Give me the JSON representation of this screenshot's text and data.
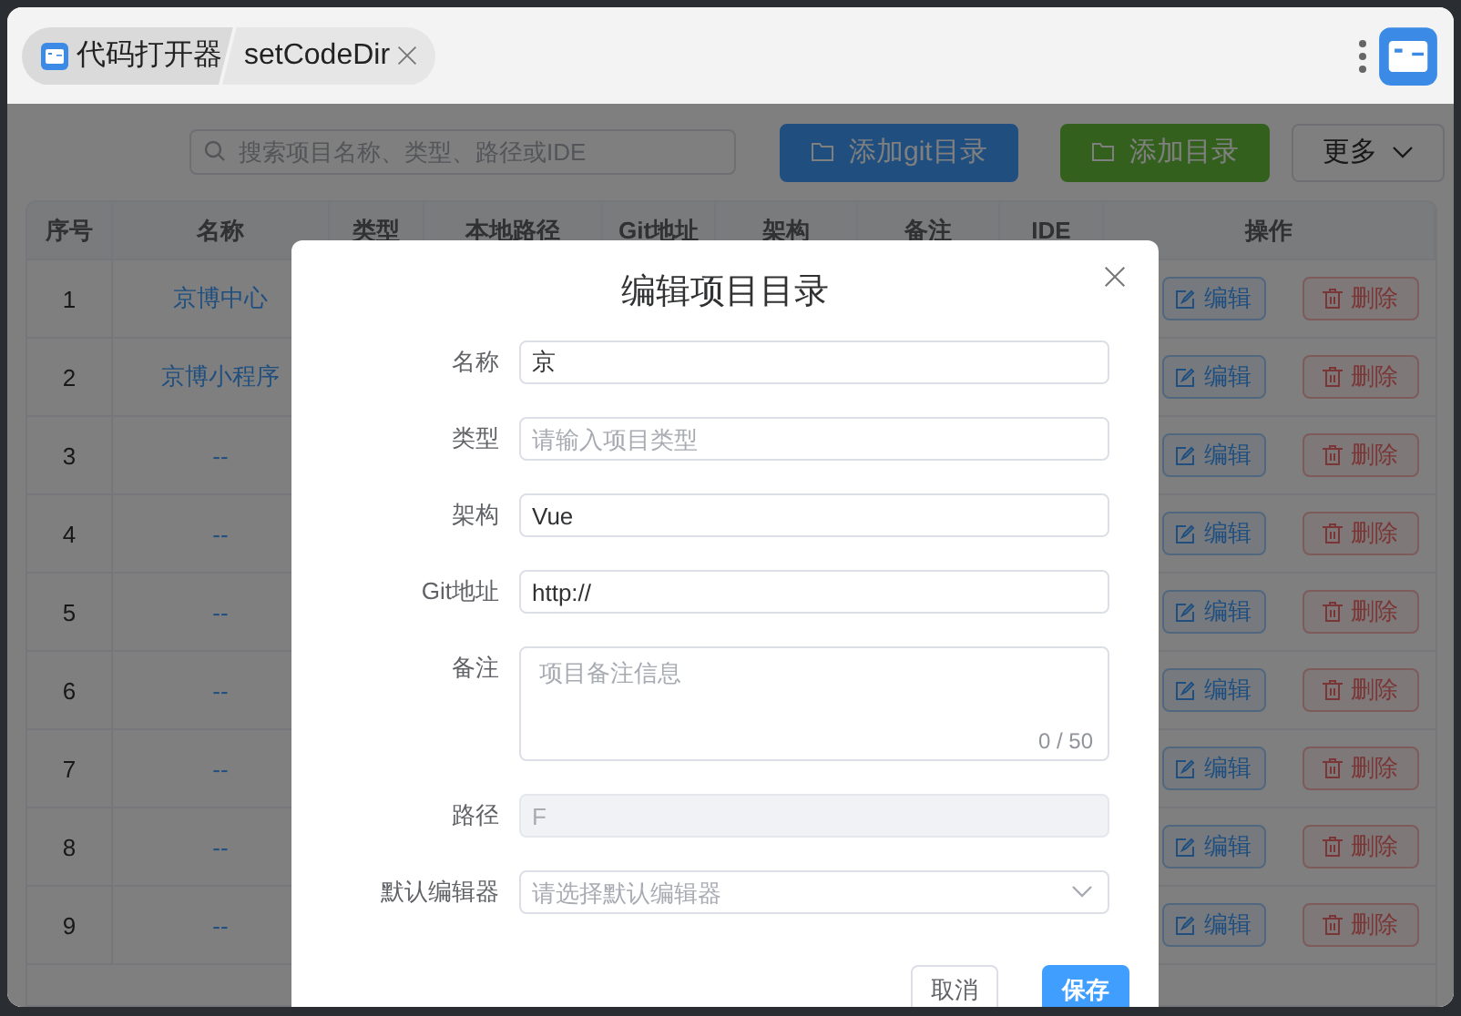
{
  "window": {
    "tabs": [
      {
        "label": "代码打开器",
        "kind": "home"
      },
      {
        "label": "setCodeDir",
        "kind": "page"
      }
    ]
  },
  "toolbar": {
    "search": {
      "placeholder": "搜索项目名称、类型、路径或IDE"
    },
    "buttons": [
      {
        "label": "添加git目录",
        "kind": "primary"
      },
      {
        "label": "添加目录",
        "kind": "success"
      },
      {
        "label": "更多",
        "kind": "dropdown"
      }
    ]
  },
  "table": {
    "columns": [
      "序号",
      "名称",
      "类型",
      "本地路径",
      "Git地址",
      "架构",
      "备注",
      "IDE",
      "操作"
    ],
    "rows": [
      {
        "seq": "1",
        "name": "京博中心",
        "actions": [
          "编辑",
          "删除"
        ]
      },
      {
        "seq": "2",
        "name": "京博小程序",
        "actions": [
          "编辑",
          "删除"
        ]
      },
      {
        "seq": "3",
        "name": "--",
        "actions": [
          "编辑",
          "删除"
        ]
      },
      {
        "seq": "4",
        "name": "--",
        "actions": [
          "编辑",
          "删除"
        ]
      },
      {
        "seq": "5",
        "name": "--",
        "actions": [
          "编辑",
          "删除"
        ]
      },
      {
        "seq": "6",
        "name": "--",
        "actions": [
          "编辑",
          "删除"
        ]
      },
      {
        "seq": "7",
        "name": "--",
        "actions": [
          "编辑",
          "删除"
        ]
      },
      {
        "seq": "8",
        "name": "--",
        "actions": [
          "编辑",
          "删除"
        ]
      },
      {
        "seq": "9",
        "name": "--",
        "actions": [
          "编辑",
          "删除"
        ]
      }
    ]
  },
  "dialog": {
    "title": "编辑项目目录",
    "fields": [
      {
        "label": "名称",
        "kind": "input",
        "value": "京",
        "disabled": false
      },
      {
        "label": "类型",
        "kind": "input",
        "placeholder": "请输入项目类型",
        "disabled": false
      },
      {
        "label": "架构",
        "kind": "input",
        "value": "Vue",
        "disabled": false
      },
      {
        "label": "Git地址",
        "kind": "input",
        "value": "http://",
        "disabled": false
      },
      {
        "label": "备注",
        "kind": "textarea",
        "placeholder": "项目备注信息",
        "counter": "0 / 50",
        "disabled": false
      },
      {
        "label": "路径",
        "kind": "input",
        "value": "F",
        "disabled": true
      },
      {
        "label": "默认编辑器",
        "kind": "select",
        "placeholder": "请选择默认编辑器",
        "disabled": false
      }
    ],
    "buttons": [
      {
        "label": "取消",
        "kind": "default"
      },
      {
        "label": "保存",
        "kind": "primary"
      }
    ]
  }
}
